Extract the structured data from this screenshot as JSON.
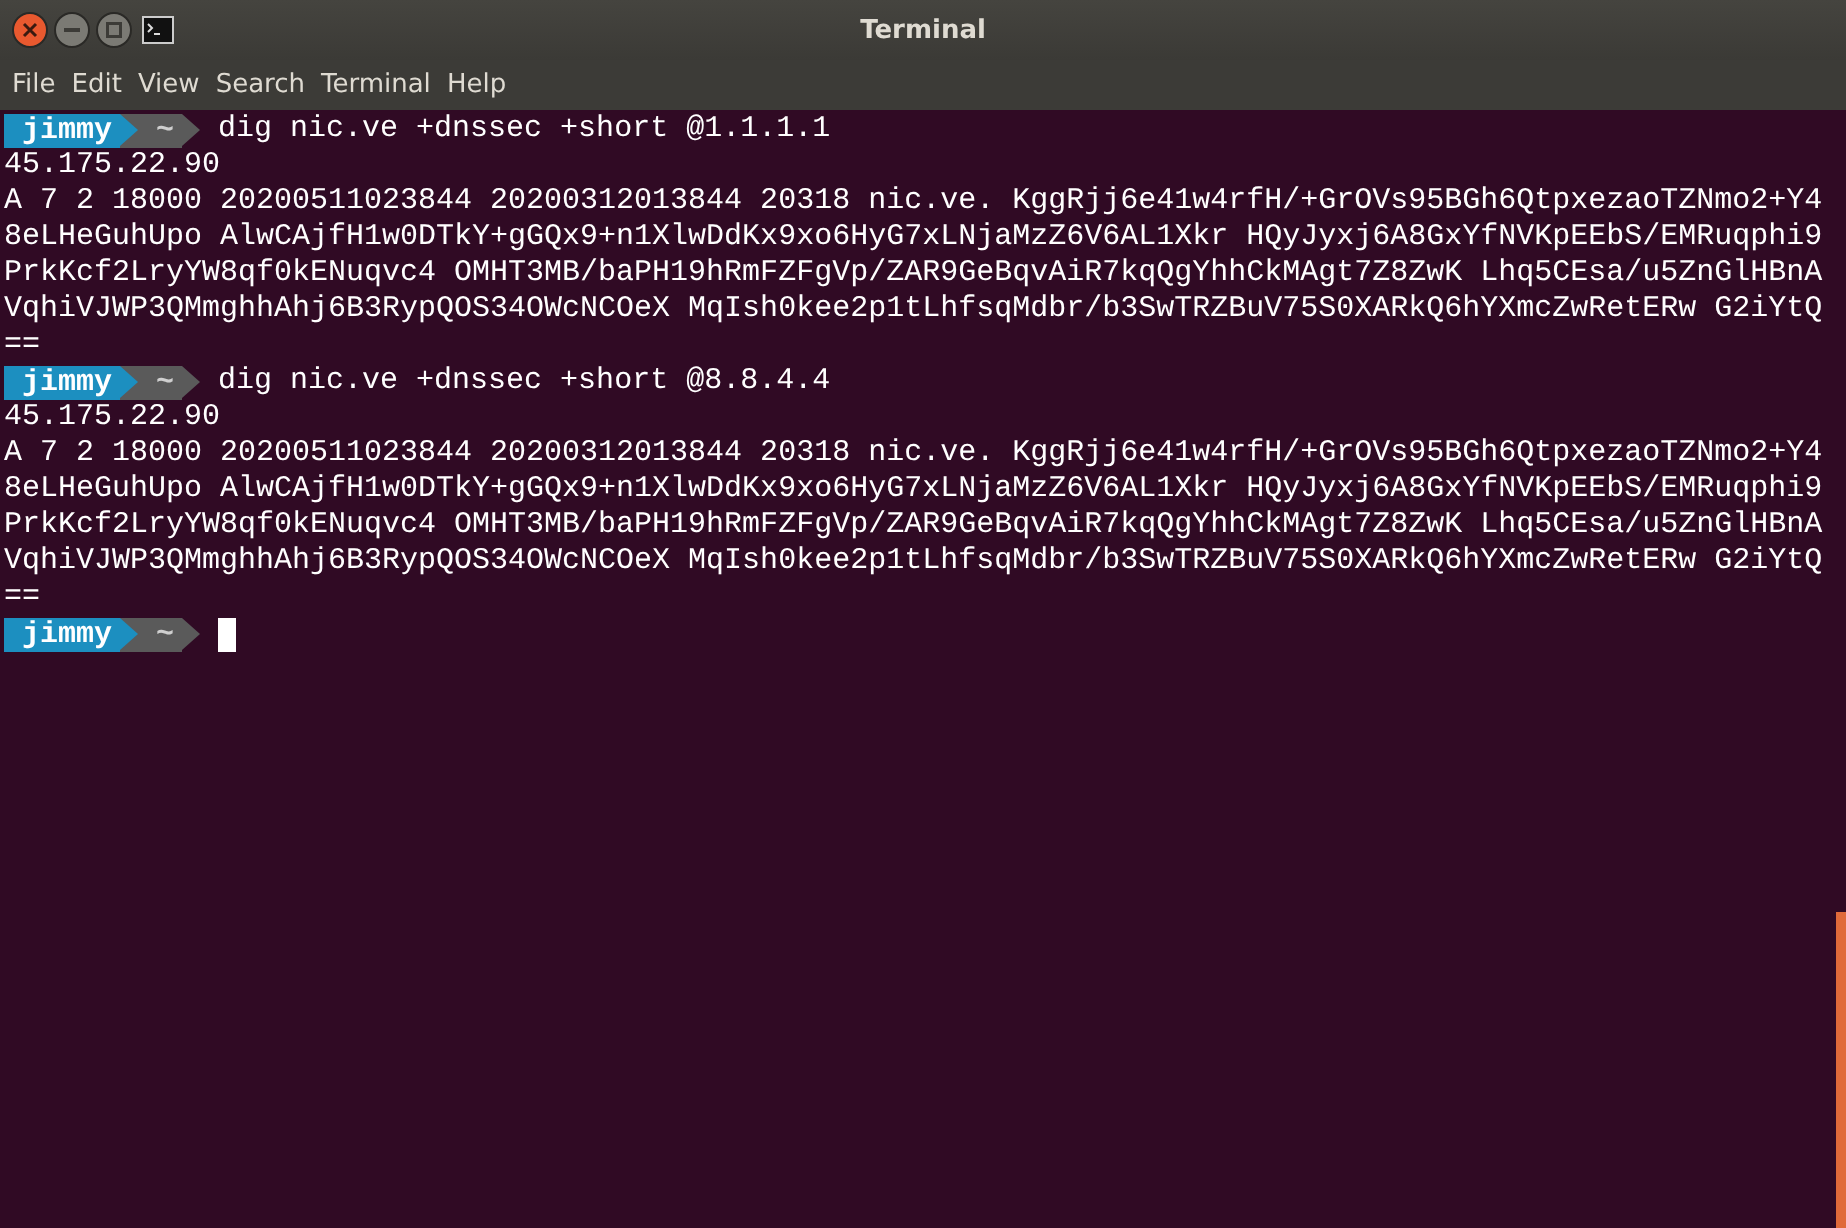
{
  "window": {
    "title": "Terminal"
  },
  "menu": [
    "File",
    "Edit",
    "View",
    "Search",
    "Terminal",
    "Help"
  ],
  "lines": [
    {
      "kind": "prompt",
      "user": "jimmy",
      "dir": "~",
      "command": "dig nic.ve +dnssec +short @1.1.1.1",
      "cursor": false
    },
    {
      "kind": "output",
      "text": "45.175.22.90"
    },
    {
      "kind": "output",
      "text": "A 7 2 18000 20200511023844 20200312013844 20318 nic.ve. KggRjj6e41w4rfH/+GrOVs95BGh6QtpxezaoTZNmo2+Y4"
    },
    {
      "kind": "output",
      "text": "8eLHeGuhUpo AlwCAjfH1w0DTkY+gGQx9+n1XlwDdKx9xo6HyG7xLNjaMzZ6V6AL1Xkr HQyJyxj6A8GxYfNVKpEEbS/EMRuqphi9"
    },
    {
      "kind": "output",
      "text": "PrkKcf2LryYW8qf0kENuqvc4 OMHT3MB/baPH19hRmFZFgVp/ZAR9GeBqvAiR7kqQgYhhCkMAgt7Z8ZwK Lhq5CEsa/u5ZnGlHBnA"
    },
    {
      "kind": "output",
      "text": "VqhiVJWP3QMmghhAhj6B3RypQOS34OWcNCOeX MqIsh0kee2p1tLhfsqMdbr/b3SwTRZBuV75S0XARkQ6hYXmcZwRetERw G2iYtQ"
    },
    {
      "kind": "output",
      "text": "=="
    },
    {
      "kind": "prompt",
      "user": "jimmy",
      "dir": "~",
      "command": "dig nic.ve +dnssec +short @8.8.4.4",
      "cursor": false
    },
    {
      "kind": "output",
      "text": "45.175.22.90"
    },
    {
      "kind": "output",
      "text": "A 7 2 18000 20200511023844 20200312013844 20318 nic.ve. KggRjj6e41w4rfH/+GrOVs95BGh6QtpxezaoTZNmo2+Y4"
    },
    {
      "kind": "output",
      "text": "8eLHeGuhUpo AlwCAjfH1w0DTkY+gGQx9+n1XlwDdKx9xo6HyG7xLNjaMzZ6V6AL1Xkr HQyJyxj6A8GxYfNVKpEEbS/EMRuqphi9"
    },
    {
      "kind": "output",
      "text": "PrkKcf2LryYW8qf0kENuqvc4 OMHT3MB/baPH19hRmFZFgVp/ZAR9GeBqvAiR7kqQgYhhCkMAgt7Z8ZwK Lhq5CEsa/u5ZnGlHBnA"
    },
    {
      "kind": "output",
      "text": "VqhiVJWP3QMmghhAhj6B3RypQOS34OWcNCOeX MqIsh0kee2p1tLhfsqMdbr/b3SwTRZBuV75S0XARkQ6hYXmcZwRetERw G2iYtQ"
    },
    {
      "kind": "output",
      "text": "=="
    },
    {
      "kind": "prompt",
      "user": "jimmy",
      "dir": "~",
      "cursor": true
    }
  ]
}
